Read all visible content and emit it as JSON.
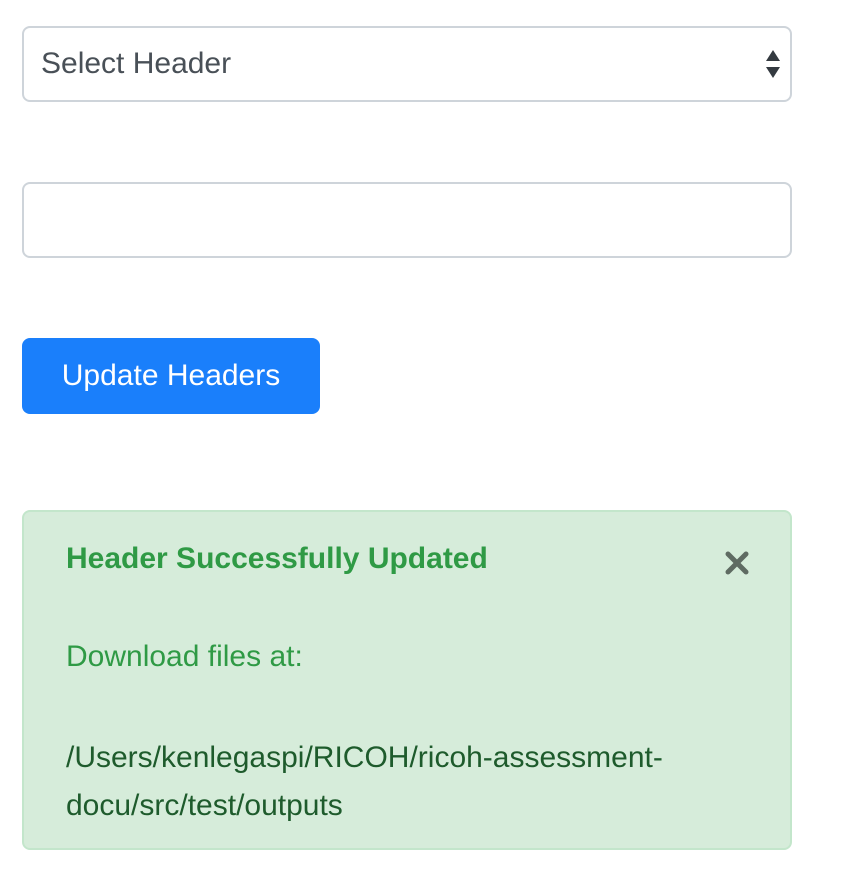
{
  "header_select": {
    "selected": "Select Header",
    "icon": "up-down-arrows-icon"
  },
  "header_input": {
    "value": "",
    "placeholder": ""
  },
  "update_button": {
    "label": "Update Headers",
    "color": "#1a7ffb"
  },
  "alert": {
    "title": "Header Successfully Updated",
    "message": "Download files at:",
    "path_line1": "/Users/kenlegaspi/RICOH/ricoh-assessment-",
    "path_line2": "docu/src/test/outputs",
    "close_icon": "close-icon",
    "background_color": "#d6ecda",
    "text_color": "#2f9a45"
  }
}
